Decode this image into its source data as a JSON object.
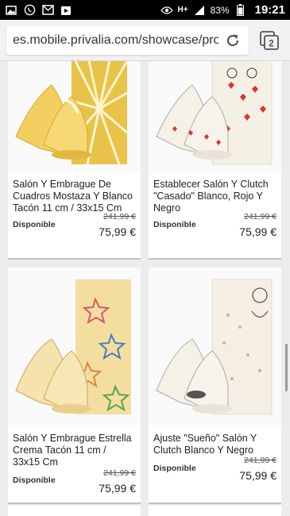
{
  "statusbar": {
    "battery": "83%",
    "time": "19:21",
    "network": "H+"
  },
  "browser": {
    "url": "es.mobile.privalia.com/showcase/prod",
    "tab_count": "2"
  },
  "products": [
    {
      "title": "Salón Y Embrague De Cuadros Mostaza Y Blanco Tacón 11 cm / 33x15 Cm",
      "status": "Disponible",
      "old_price": "241,99 €",
      "price": "75,99 €",
      "image": "mustard-shoes-clutch"
    },
    {
      "title": "Establecer Salón Y Clutch \"Casado\" Blanco, Rojo Y Negro",
      "status": "Disponible",
      "old_price": "241,99 €",
      "price": "75,99 €",
      "image": "married-shoes-clutch"
    },
    {
      "title": "Salón Y Embrague Estrella Crema Tacón 11 cm / 33x15 Cm",
      "status": "Disponible",
      "old_price": "241,99 €",
      "price": "75,99 €",
      "image": "star-shoes-clutch"
    },
    {
      "title": "Ajuste \"Sueño\" Salón Y Clutch Blanco Y Negro",
      "status": "Disponible",
      "old_price": "241,99 €",
      "price": "75,99 €",
      "image": "dream-shoes-clutch"
    }
  ]
}
